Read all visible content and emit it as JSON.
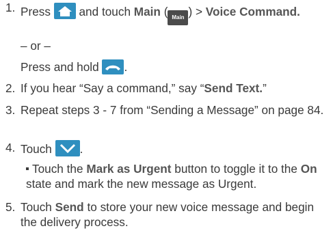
{
  "steps": [
    {
      "num": "1.",
      "a": "Press",
      "b": "and touch",
      "main": "Main",
      "c": "(",
      "d": ") >",
      "voice": "Voice Command.",
      "or": "– or –",
      "press_hold": "Press and hold",
      "period": "."
    },
    {
      "num": "2.",
      "a": "If you hear “Say a command,” say “",
      "send_text": "Send Text.",
      "b": "”"
    },
    {
      "num": "3.",
      "text": "Repeat steps 3 - 7 from “Sending a Message” on page 84."
    },
    {
      "num": "4.",
      "a": "Touch",
      "period": "."
    },
    {
      "num": "5.",
      "a": "Touch",
      "send": "Send",
      "b": "to store your new voice message and begin the delivery process."
    }
  ],
  "bullet": {
    "a": "Touch the",
    "mark": "Mark as Urgent",
    "b": "button to toggle it to the",
    "on": "On",
    "c": "state and mark the new message as Urgent."
  },
  "icons": {
    "main_label": "Main"
  },
  "colors": {
    "icon_blue": "#2f8fbf"
  }
}
